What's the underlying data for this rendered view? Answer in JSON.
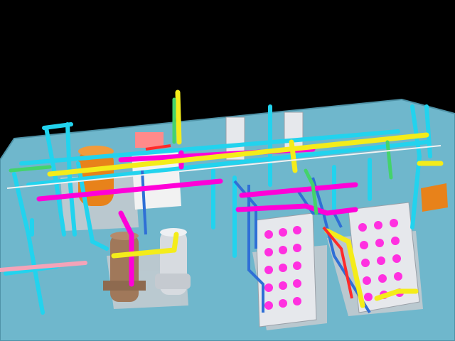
{
  "scene": {
    "subject": "plant-layout-3d-model",
    "colors": {
      "background": "#000000",
      "platform": "#6fb7cc",
      "platform_edge": "#4f93a8",
      "cyan_pipe": "#22d3ee",
      "yellow_pipe": "#f4ec1a",
      "magenta_pipe": "#ff00d8",
      "white_pipe": "#f2f2f2",
      "green_pipe": "#44d36b",
      "orange_tank": "#e8821a",
      "brown_vessel": "#a0785a",
      "grey_vessel": "#d7dbe0",
      "steel_blue": "#2f6fd6",
      "red_pipe": "#ff2a2a",
      "pink_pipe": "#f4a3b8"
    }
  }
}
